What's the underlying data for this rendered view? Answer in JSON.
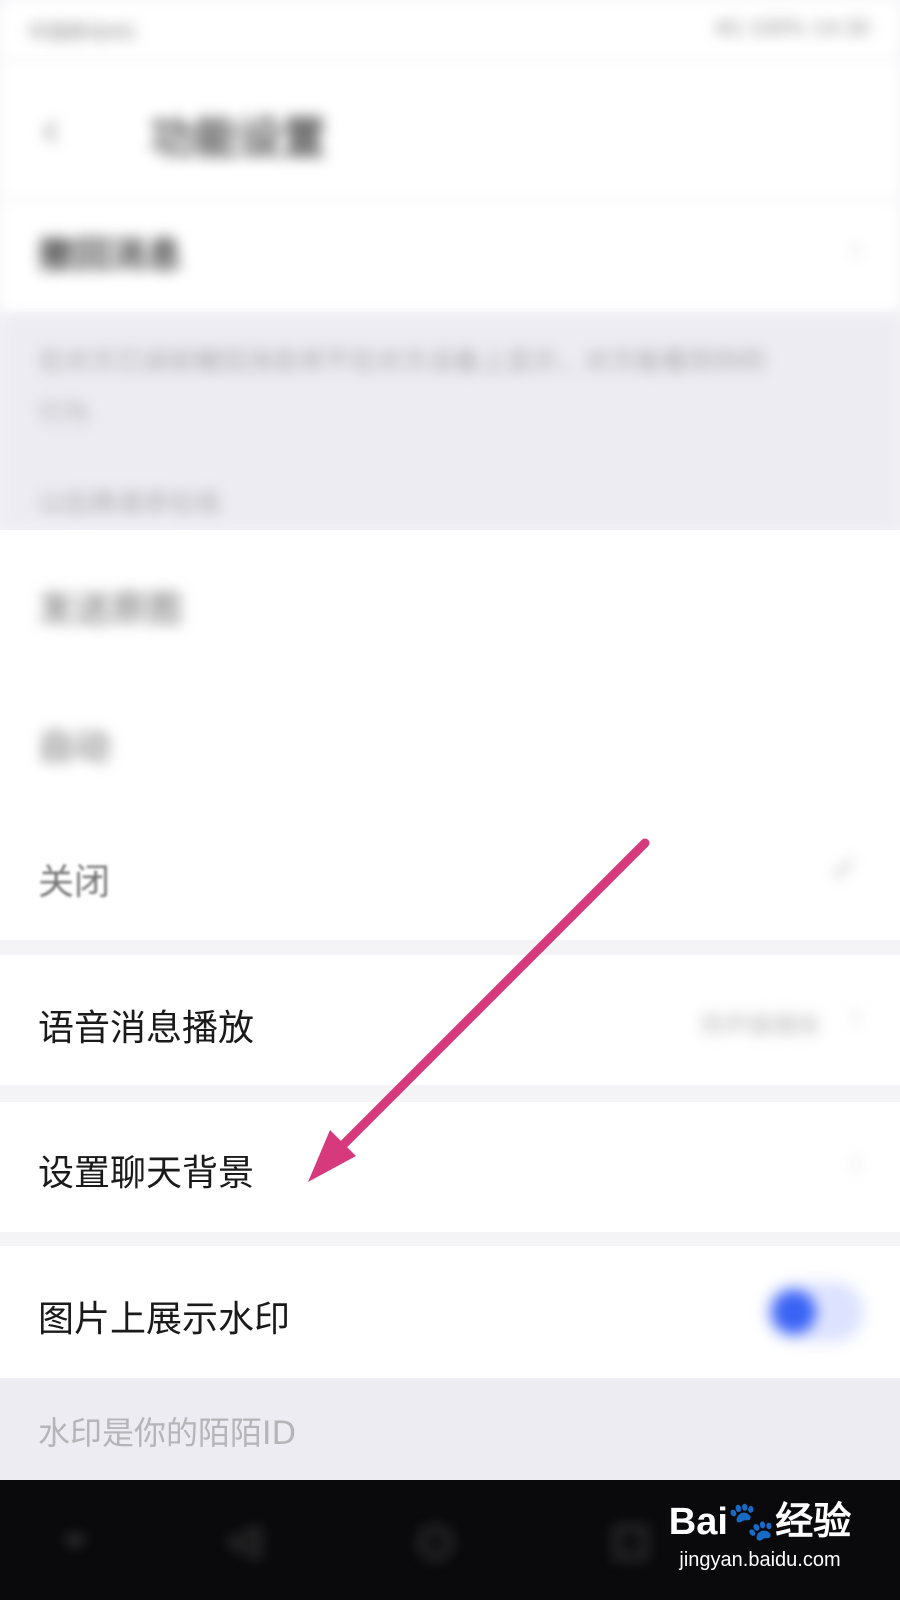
{
  "status_bar": {
    "left_text": "中国移动4G",
    "right_text": "4G 100% 14:30"
  },
  "header": {
    "title": "功能设置"
  },
  "rows": {
    "recall": {
      "label": "撤回消息"
    },
    "recall_desc": {
      "line1": "在对方已读前撤回消息将不在对方设备上显示，对方能看到你的",
      "line2": "行为",
      "line3": "以后再请求在线"
    },
    "send_original": {
      "label": "发送原图"
    },
    "auto": {
      "label": "自动"
    },
    "close": {
      "label": "关闭"
    },
    "voice_play": {
      "label": "语音消息播放",
      "value": "扬声器播放"
    },
    "chat_bg": {
      "label": "设置聊天背景"
    },
    "watermark_toggle": {
      "label": "图片上展示水印",
      "enabled": true
    },
    "watermark_desc": {
      "text": "水印是你的陌陌ID"
    }
  },
  "icons": {
    "back": "back-arrow-icon",
    "chevron": "chevron-right-icon",
    "check": "checkmark-icon",
    "nav_down": "chevron-down-icon",
    "nav_back": "triangle-back-icon",
    "nav_home": "circle-home-icon",
    "nav_recent": "square-recent-icon"
  },
  "annotation": {
    "arrow_color": "#d63a7c"
  },
  "watermark_brand": {
    "logo": "Bai🐾经验",
    "url": "jingyan.baidu.com"
  }
}
